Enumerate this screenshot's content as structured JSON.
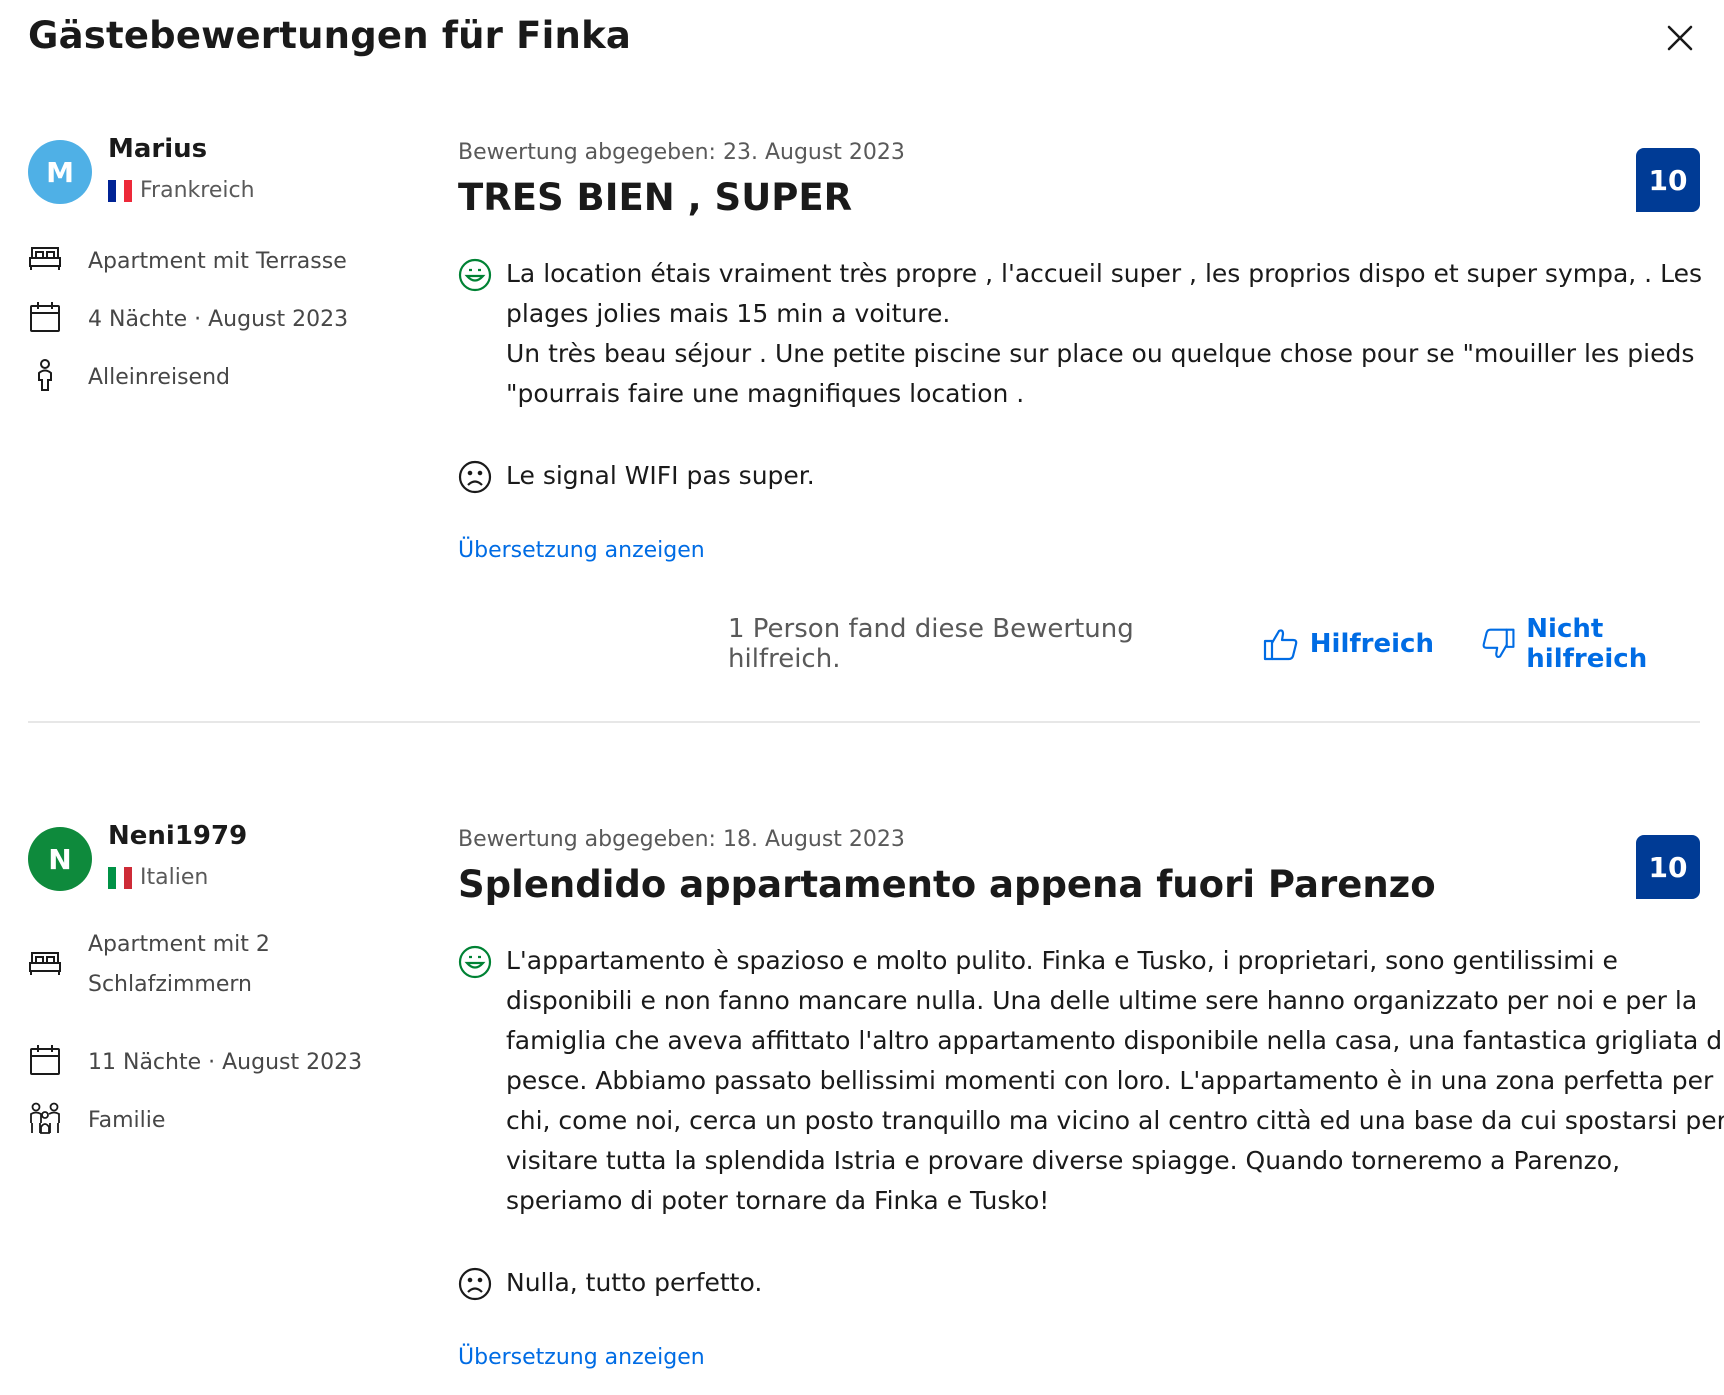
{
  "modal": {
    "title": "Gästebewertungen für Finka",
    "close_icon": "close-icon"
  },
  "colors": {
    "score_badge": "#003b95",
    "link": "#006ce4",
    "positive": "#008234",
    "avatar_1": "#4fb0e6",
    "avatar_2": "#0e8a3c"
  },
  "reviews": [
    {
      "avatar_initial": "M",
      "name": "Marius",
      "country": "Frankreich",
      "room": "Apartment mit Terrasse",
      "stay": "4 Nächte · August 2023",
      "traveler_type": "Alleinreisend",
      "date": "Bewertung abgegeben: 23. August 2023",
      "title": "TRES BIEN , SUPER",
      "score": "10",
      "positive_line_1": "La location étais vraiment très propre , l'accueil super , les proprios dispo et super sympa, . Les plages jolies mais 15 min a voiture.",
      "positive_line_2": "Un très beau séjour . Une petite piscine sur place ou quelque chose pour se \"mouiller les pieds \"pourrais faire une magnifiques location .",
      "negative": "Le signal WIFI pas super.",
      "translate_link": "Übersetzung anzeigen",
      "helpful_count": "1 Person fand diese Bewertung hilfreich.",
      "helpful_label": "Hilfreich",
      "not_helpful_label": "Nicht hilfreich"
    },
    {
      "avatar_initial": "N",
      "name": "Neni1979",
      "country": "Italien",
      "room": "Apartment mit 2 Schlafzimmern",
      "stay": "11 Nächte · August 2023",
      "traveler_type": "Familie",
      "date": "Bewertung abgegeben: 18. August 2023",
      "title": "Splendido appartamento appena fuori Parenzo",
      "score": "10",
      "positive": "L'appartamento è spazioso e molto pulito. Finka e Tusko, i proprietari, sono gentilissimi e disponibili e non fanno mancare nulla. Una delle ultime sere hanno organizzato per noi e per la famiglia che aveva affittato l'altro appartamento disponibile nella casa, una fantastica grigliata di pesce. Abbiamo passato bellissimi momenti con loro. L'appartamento è in una zona perfetta per chi, come noi, cerca un posto tranquillo ma vicino al centro città ed una base da cui spostarsi per visitare tutta la splendida Istria e provare diverse spiagge. Quando torneremo a Parenzo, speriamo di poter tornare da Finka e Tusko!",
      "negative": "Nulla, tutto perfetto.",
      "translate_link": "Übersetzung anzeigen"
    }
  ]
}
